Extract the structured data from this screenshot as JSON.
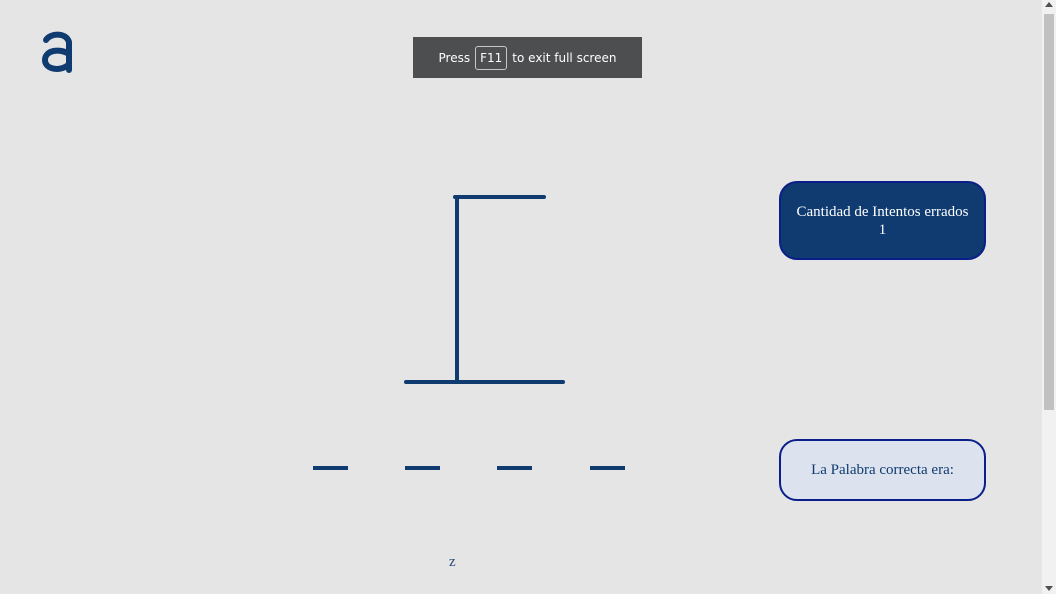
{
  "logo": {
    "icon": "a-logo-icon",
    "color": "#0f3b70"
  },
  "fullscreen_toast": {
    "prefix": "Press",
    "key": "F11",
    "suffix": "to exit full screen"
  },
  "game": {
    "word_blanks": [
      "",
      "",
      "",
      ""
    ],
    "tried_letters": "z",
    "wrong_attempts": {
      "label": "Cantidad de Intentos errados",
      "count": "1"
    },
    "answer": {
      "label": "La Palabra correcta era:",
      "word": ""
    }
  },
  "colors": {
    "primary": "#0f3b70",
    "border": "#0a1f8a",
    "background": "#e5e5e5",
    "answer_bg": "#dde3ee"
  }
}
